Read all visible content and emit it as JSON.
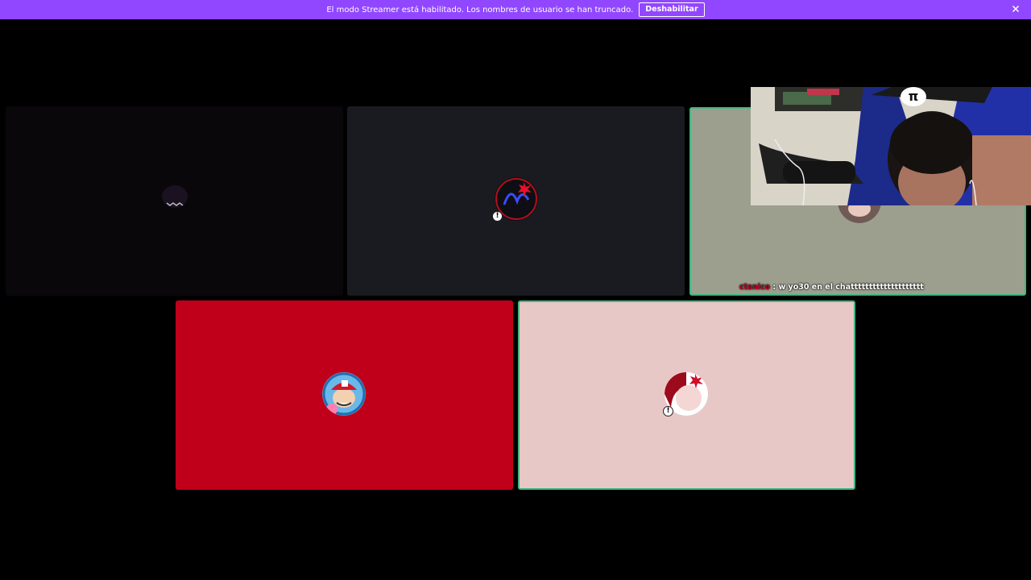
{
  "banner": {
    "message": "El modo Streamer está habilitado. Los nombres de usuario se han truncado.",
    "disable_label": "Deshabilitar",
    "close_icon": "close-icon",
    "bg_color": "#9147ff"
  },
  "tiles": [
    {
      "id": "tile-1",
      "bg": "#0a070b",
      "avatar": "dark-creature-avatar",
      "muted": false
    },
    {
      "id": "tile-2",
      "bg": "#1a1b20",
      "avatar": "austin-logo-avatar",
      "muted": true
    },
    {
      "id": "tile-3",
      "bg": "#9c9f8e",
      "avatar": "partial-avatar",
      "muted": false,
      "speaking": true
    },
    {
      "id": "tile-4",
      "bg": "#c0001a",
      "avatar": "cartoon-cap-avatar",
      "muted": false
    },
    {
      "id": "tile-5",
      "bg": "#e8c8c6",
      "avatar": "pink-character-avatar",
      "muted": true,
      "speaking": true
    }
  ],
  "chat_overlay": {
    "username": "ctsnico",
    "separator": ":",
    "message": "w yo30 en el chatttttttttttttttttttt"
  },
  "webcam": {
    "chair_logo": "π"
  },
  "mute_icon_text": "!"
}
